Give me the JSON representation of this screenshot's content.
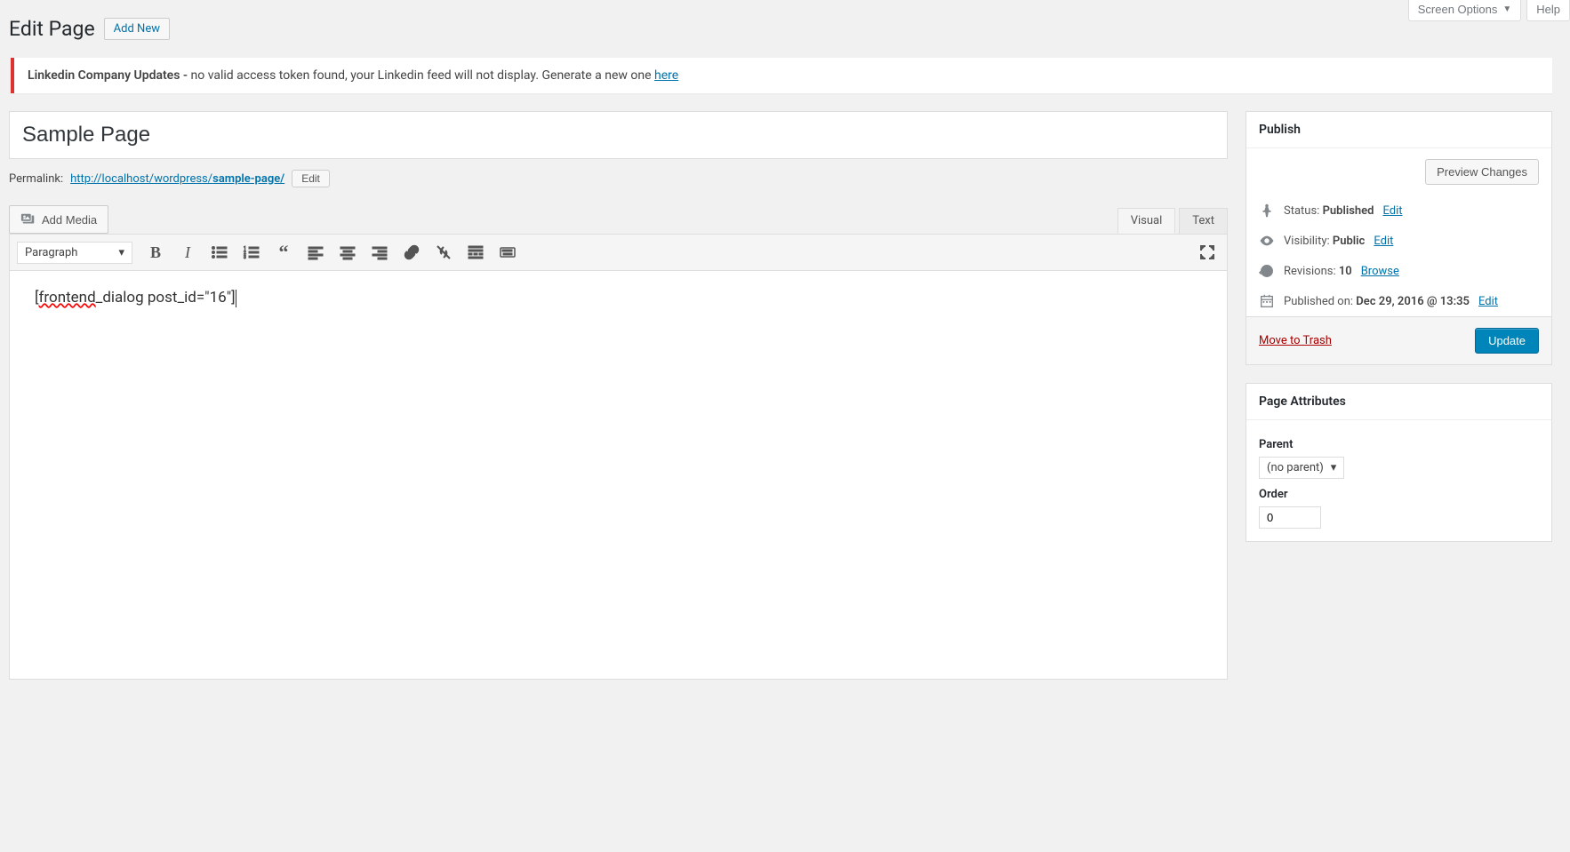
{
  "topButtons": {
    "screenOptions": "Screen Options",
    "help": "Help"
  },
  "header": {
    "title": "Edit Page",
    "addNew": "Add New"
  },
  "notice": {
    "bold": "Linkedin Company Updates -",
    "text": " no valid access token found, your Linkedin feed will not display. Generate a new one ",
    "linkText": "here"
  },
  "post": {
    "title": "Sample Page",
    "permalinkLabel": "Permalink:",
    "permalinkBase": "http://localhost/wordpress/",
    "permalinkSlug": "sample-page/",
    "editBtn": "Edit",
    "addMedia": "Add Media",
    "tabVisual": "Visual",
    "tabText": "Text",
    "formatSelect": "Paragraph",
    "content": "[frontend_dialog post_id=\"16\"]"
  },
  "publish": {
    "heading": "Publish",
    "preview": "Preview Changes",
    "statusLabel": "Status:",
    "statusValue": "Published",
    "statusEdit": "Edit",
    "visibilityLabel": "Visibility:",
    "visibilityValue": "Public",
    "visibilityEdit": "Edit",
    "revisionsLabel": "Revisions:",
    "revisionsValue": "10",
    "revisionsBrowse": "Browse",
    "publishedLabel": "Published on:",
    "publishedValue": "Dec 29, 2016 @ 13:35",
    "publishedEdit": "Edit",
    "trash": "Move to Trash",
    "update": "Update"
  },
  "pageAttributes": {
    "heading": "Page Attributes",
    "parentLabel": "Parent",
    "parentValue": "(no parent)",
    "orderLabel": "Order",
    "orderValue": "0"
  }
}
